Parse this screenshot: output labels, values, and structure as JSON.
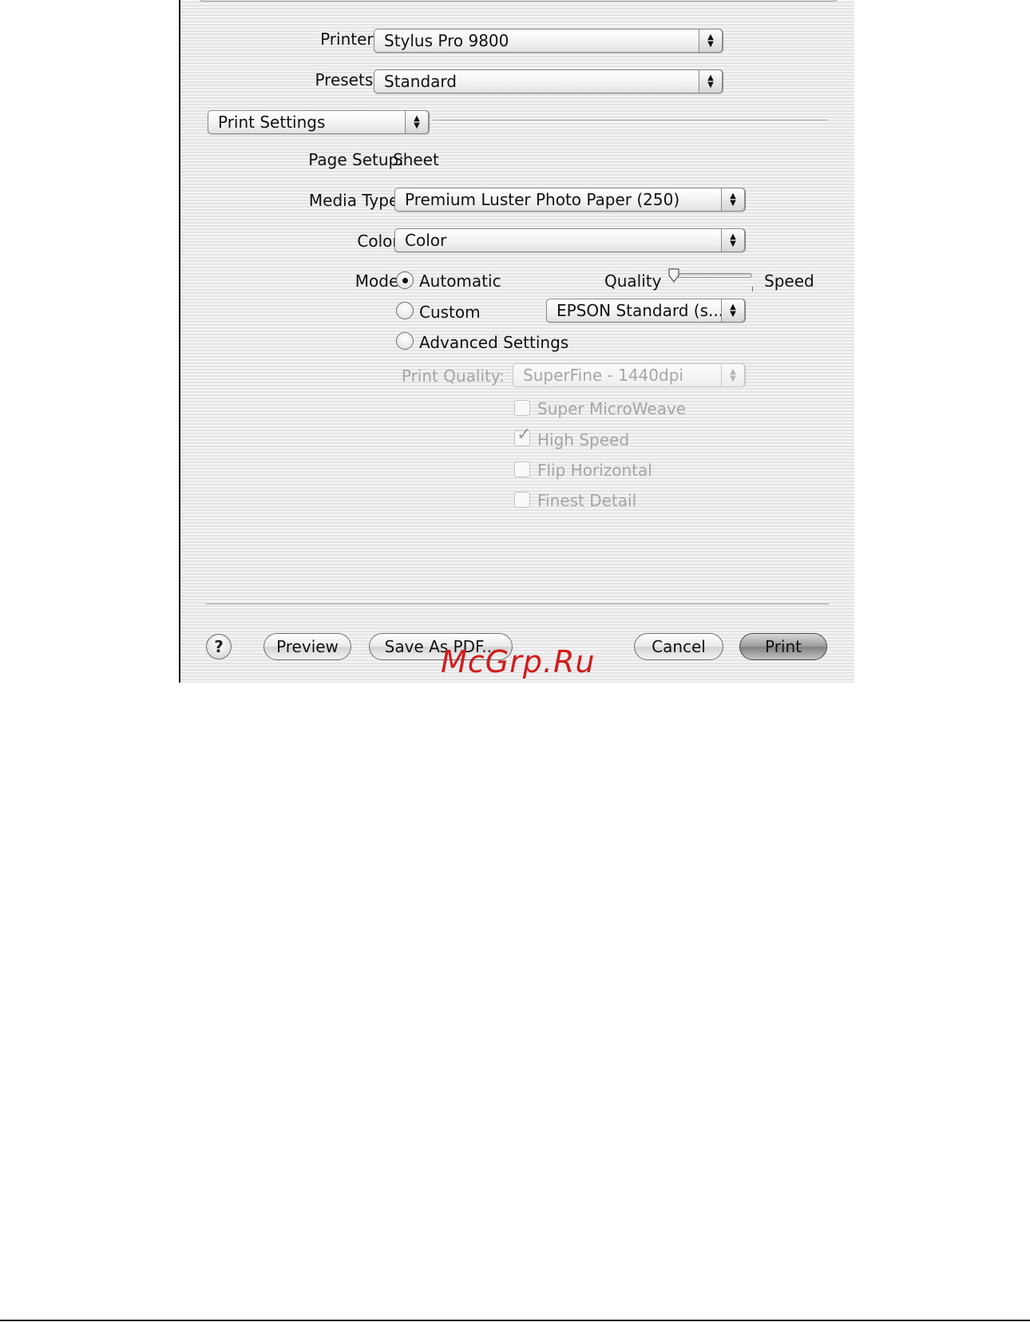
{
  "dialog": {
    "printer_label": "Printer:",
    "printer_value": "Stylus Pro 9800",
    "presets_label": "Presets:",
    "presets_value": "Standard",
    "panel_value": "Print Settings",
    "page_setup_label": "Page Setup:",
    "page_setup_value": "Sheet",
    "media_type_label": "Media Type:",
    "media_type_value": "Premium Luster Photo Paper (250)",
    "color_label": "Color:",
    "color_value": "Color",
    "mode_label": "Mode:",
    "mode_options": [
      {
        "label": "Automatic",
        "selected": true
      },
      {
        "label": "Custom",
        "selected": false
      },
      {
        "label": "Advanced Settings",
        "selected": false
      }
    ],
    "slider": {
      "left_label": "Quality",
      "right_label": "Speed",
      "level": 0
    },
    "custom_setting_value": "EPSON Standard (s...",
    "print_quality_label": "Print Quality:",
    "print_quality_value": "SuperFine - 1440dpi",
    "checkboxes": [
      {
        "label": "Super MicroWeave",
        "checked": false
      },
      {
        "label": "High Speed",
        "checked": true
      },
      {
        "label": "Flip Horizontal",
        "checked": false
      },
      {
        "label": "Finest Detail",
        "checked": false
      }
    ],
    "buttons": {
      "help": "?",
      "preview": "Preview",
      "save_pdf": "Save As PDF...",
      "cancel": "Cancel",
      "print": "Print"
    }
  },
  "watermark": "McGrp.Ru"
}
